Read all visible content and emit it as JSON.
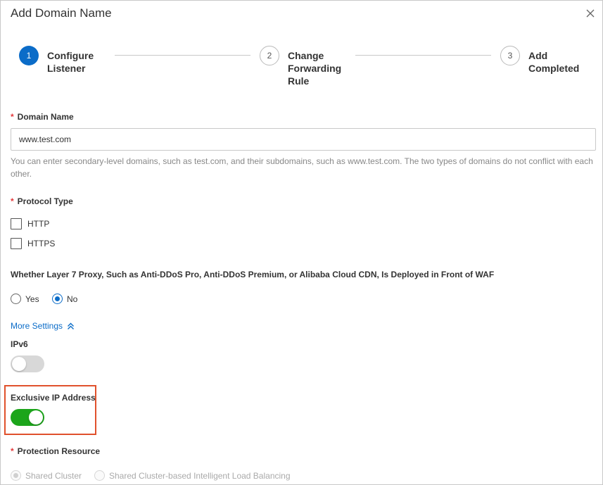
{
  "dialog": {
    "title": "Add Domain Name",
    "close_icon": "close-icon"
  },
  "steps": [
    {
      "number": "1",
      "label": "Configure\nListener",
      "state": "active"
    },
    {
      "number": "2",
      "label": "Change\nForwarding\nRule",
      "state": "inactive"
    },
    {
      "number": "3",
      "label": "Add\nCompleted",
      "state": "inactive"
    }
  ],
  "domain": {
    "required_mark": "*",
    "label": "Domain Name",
    "value": "www.test.com",
    "help": "You can enter secondary-level domains, such as test.com, and their subdomains, such as www.test.com. The two types of domains do not conflict with each other."
  },
  "protocol": {
    "required_mark": "*",
    "label": "Protocol Type",
    "options": [
      {
        "label": "HTTP",
        "checked": false
      },
      {
        "label": "HTTPS",
        "checked": false
      }
    ]
  },
  "proxy": {
    "label": "Whether Layer 7 Proxy, Such as Anti-DDoS Pro, Anti-DDoS Premium, or Alibaba Cloud CDN, Is Deployed in Front of WAF",
    "options": [
      {
        "label": "Yes",
        "checked": false
      },
      {
        "label": "No",
        "checked": true
      }
    ]
  },
  "more_settings": {
    "label": "More Settings",
    "icon": "double-chevron-up-icon"
  },
  "ipv6": {
    "label": "IPv6",
    "enabled": false
  },
  "exclusive_ip": {
    "label": "Exclusive IP Address",
    "enabled": true
  },
  "protection": {
    "required_mark": "*",
    "label": "Protection Resource",
    "options": [
      {
        "label": "Shared Cluster",
        "checked": true,
        "disabled": true
      },
      {
        "label": "Shared Cluster-based Intelligent Load Balancing",
        "checked": false,
        "disabled": true
      }
    ]
  },
  "colors": {
    "primary": "#0b6cc8",
    "required": "#e4393c",
    "switch_on": "#1ca51b",
    "switch_off": "#d8d8d8",
    "highlight": "#e0512c"
  }
}
